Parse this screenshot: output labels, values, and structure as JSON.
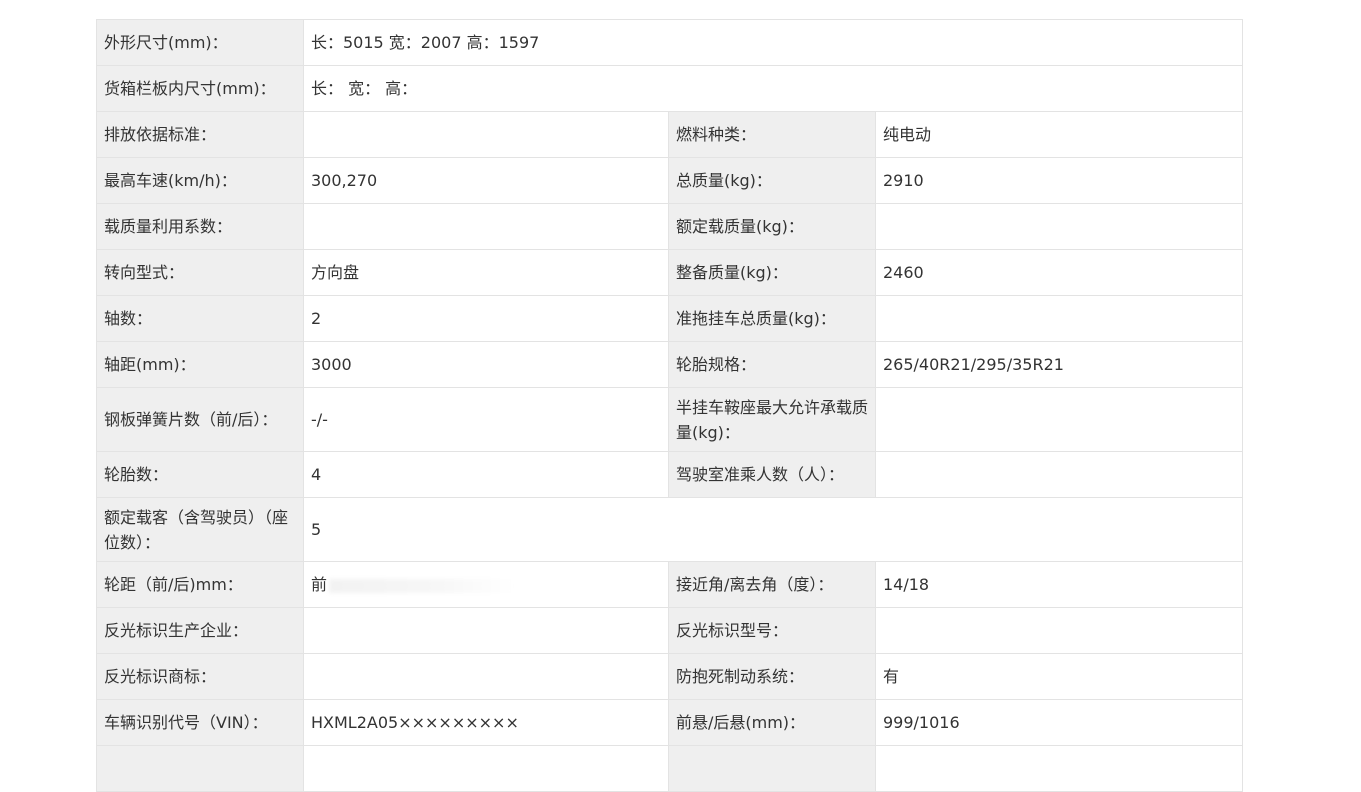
{
  "rows": [
    {
      "l1": "外形尺寸(mm)：",
      "v1": "长：5015 宽：2007 高：1597"
    },
    {
      "l1": "货箱栏板内尺寸(mm)：",
      "v1": "长：  宽：  高："
    },
    {
      "l1": "排放依据标准：",
      "v1": "",
      "l2": "燃料种类：",
      "v2": "纯电动"
    },
    {
      "l1": "最高车速(km/h)：",
      "v1": "300,270",
      "l2": "总质量(kg)：",
      "v2": "2910"
    },
    {
      "l1": "载质量利用系数：",
      "v1": "",
      "l2": "额定载质量(kg)：",
      "v2": ""
    },
    {
      "l1": "转向型式：",
      "v1": "方向盘",
      "l2": "整备质量(kg)：",
      "v2": "2460"
    },
    {
      "l1": "轴数：",
      "v1": "2",
      "l2": "准拖挂车总质量(kg)：",
      "v2": ""
    },
    {
      "l1": "轴距(mm)：",
      "v1": "3000",
      "l2": "轮胎规格：",
      "v2": "265/40R21/295/35R21"
    },
    {
      "l1": "钢板弹簧片数（前/后）：",
      "v1": "-/-",
      "l2": "半挂车鞍座最大允许承载质量(kg)：",
      "v2": ""
    },
    {
      "l1": "轮胎数：",
      "v1": "4",
      "l2": "驾驶室准乘人数（人）：",
      "v2": ""
    },
    {
      "l1": "额定载客（含驾驶员）（座位数）：",
      "v1": "5"
    },
    {
      "l1": "轮距（前/后)mm：",
      "v1": "前",
      "l2": "接近角/离去角（度）：",
      "v2": "14/18"
    },
    {
      "l1": "反光标识生产企业：",
      "v1": "",
      "l2": "反光标识型号：",
      "v2": ""
    },
    {
      "l1": "反光标识商标：",
      "v1": "",
      "l2": "防抱死制动系统：",
      "v2": "有"
    },
    {
      "l1": "车辆识别代号（VIN）：",
      "v1": "HXML2A05×××××××××",
      "l2": "前悬/后悬(mm)：",
      "v2": "999/1016"
    }
  ]
}
